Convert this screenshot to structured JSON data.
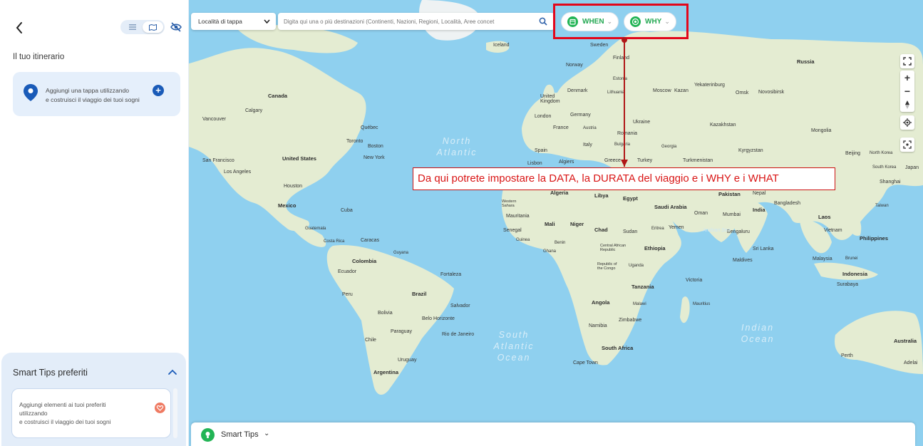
{
  "sidebar": {
    "itinerary_title": "Il tuo itinerario",
    "add_stage_line1": "Aggiungi una tappa utilizzando",
    "add_stage_line2": "e costruisci il viaggio dei tuoi sogni",
    "smart_tips_title": "Smart Tips preferiti",
    "favorites_line1": "Aggiungi elementi ai tuoi preferiti",
    "favorites_line2": "utilizzando",
    "favorites_line3": "e costruisci il viaggio dei tuoi sogni"
  },
  "toolbar": {
    "region_select": "Località di tappa",
    "search_placeholder": "Digita qui una o più destinazioni (Continenti, Nazioni, Regioni, Località, Aree concet",
    "when_label": "WHEN",
    "why_label": "WHY"
  },
  "annotation": "Da qui potrete impostare la DATA, la DURATA del viaggio e i WHY e i WHAT",
  "bottom_bar": {
    "smart_tips_label": "Smart Tips"
  },
  "colors": {
    "accent_green": "#22b455",
    "highlight_red": "#e3071b",
    "ocean": "#8fd0ef",
    "land": "#e4ecd2",
    "panel_blue": "#e3edf9"
  },
  "map": {
    "oceans": {
      "north_atlantic": "North Atlantic",
      "south_atlantic": "South Atlantic Ocean",
      "indian": "Indian Ocean"
    },
    "countries": {
      "iceland": "Iceland",
      "sweden": "Sweden",
      "finland": "Finland",
      "norway": "Norway",
      "russia": "Russia",
      "estonia": "Estonia",
      "denmark": "Denmark",
      "lithuania": "Lithuania",
      "uk": "United Kingdom",
      "london": "London",
      "moscow": "Moscow",
      "kazan": "Kazan",
      "yekaterinburg": "Yekaterinburg",
      "omsk": "Omsk",
      "novosibirsk": "Novosibirsk",
      "germany": "Germany",
      "ukraine": "Ukraine",
      "kazakhstan": "Kazakhstan",
      "mongolia": "Mongolia",
      "france": "France",
      "austria": "Austria",
      "romania": "Romania",
      "spain": "Spain",
      "italy": "Italy",
      "bulgaria": "Bulgaria",
      "georgia": "Georgia",
      "kyrgyzstan": "Kyrgyzstan",
      "beijing": "Beijing",
      "north_korea": "North Korea",
      "lisbon": "Lisbon",
      "greece": "Greece",
      "turkey": "Turkey",
      "turkmenistan": "Turkmenistan",
      "algiers": "Algiers",
      "south_korea": "South Korea",
      "japan": "Japan",
      "shanghai": "Shanghai",
      "canada": "Canada",
      "calgary": "Calgary",
      "vancouver": "Vancouver",
      "quebec": "Québec",
      "toronto": "Toronto",
      "boston": "Boston",
      "new_york": "New York",
      "san_francisco": "San Francisco",
      "united_states": "United States",
      "los_angeles": "Los Angeles",
      "houston": "Houston",
      "mexico": "Mexico",
      "cuba": "Cuba",
      "guatemala": "Guatemala",
      "costa_rica": "Costa Rica",
      "caracas": "Caracas",
      "guyana": "Guyana",
      "colombia": "Colombia",
      "ecuador": "Ecuador",
      "peru": "Peru",
      "brazil": "Brazil",
      "fortaleza": "Fortaleza",
      "salvador": "Salvador",
      "bolivia": "Bolivia",
      "belo_horizonte": "Belo Horizonte",
      "paraguay": "Paraguay",
      "rio": "Rio de Janeiro",
      "chile": "Chile",
      "uruguay": "Uruguay",
      "argentina": "Argentina",
      "algeria": "Algeria",
      "libya": "Libya",
      "egypt": "Egypt",
      "western_sahara": "Western Sahara",
      "mauritania": "Mauritania",
      "mali": "Mali",
      "niger": "Niger",
      "chad": "Chad",
      "sudan": "Sudan",
      "eritrea": "Eritrea",
      "senegal": "Senegal",
      "guinea": "Guinea",
      "benin": "Benin",
      "ghana": "Ghana",
      "car": "Central African Republic",
      "ethiopia": "Ethiopia",
      "congo": "Republic of the Congo",
      "uganda": "Uganda",
      "tanzania": "Tanzania",
      "angola": "Angola",
      "malawi": "Malawi",
      "namibia": "Namibia",
      "zimbabwe": "Zimbabwe",
      "south_africa": "South Africa",
      "cape_town": "Cape Town",
      "victoria": "Victoria",
      "mauritius": "Mauritius",
      "saudi_arabia": "Saudi Arabia",
      "oman": "Oman",
      "yemen": "Yemen",
      "pakistan": "Pakistan",
      "nepal": "Nepal",
      "india": "India",
      "mumbai": "Mumbai",
      "bangladesh": "Bangladesh",
      "bengaluru": "Bengaluru",
      "sri_lanka": "Sri Lanka",
      "maldives": "Maldives",
      "laos": "Laos",
      "vietnam": "Vietnam",
      "philippines": "Philippines",
      "malaysia": "Malaysia",
      "brunei": "Brunei",
      "indonesia": "Indonesia",
      "surabaya": "Surabaya",
      "taiwan": "Taiwan",
      "australia": "Australia",
      "perth": "Perth",
      "adelaide": "Adelai",
      "arabian_sea": "Arabian Sea"
    }
  }
}
